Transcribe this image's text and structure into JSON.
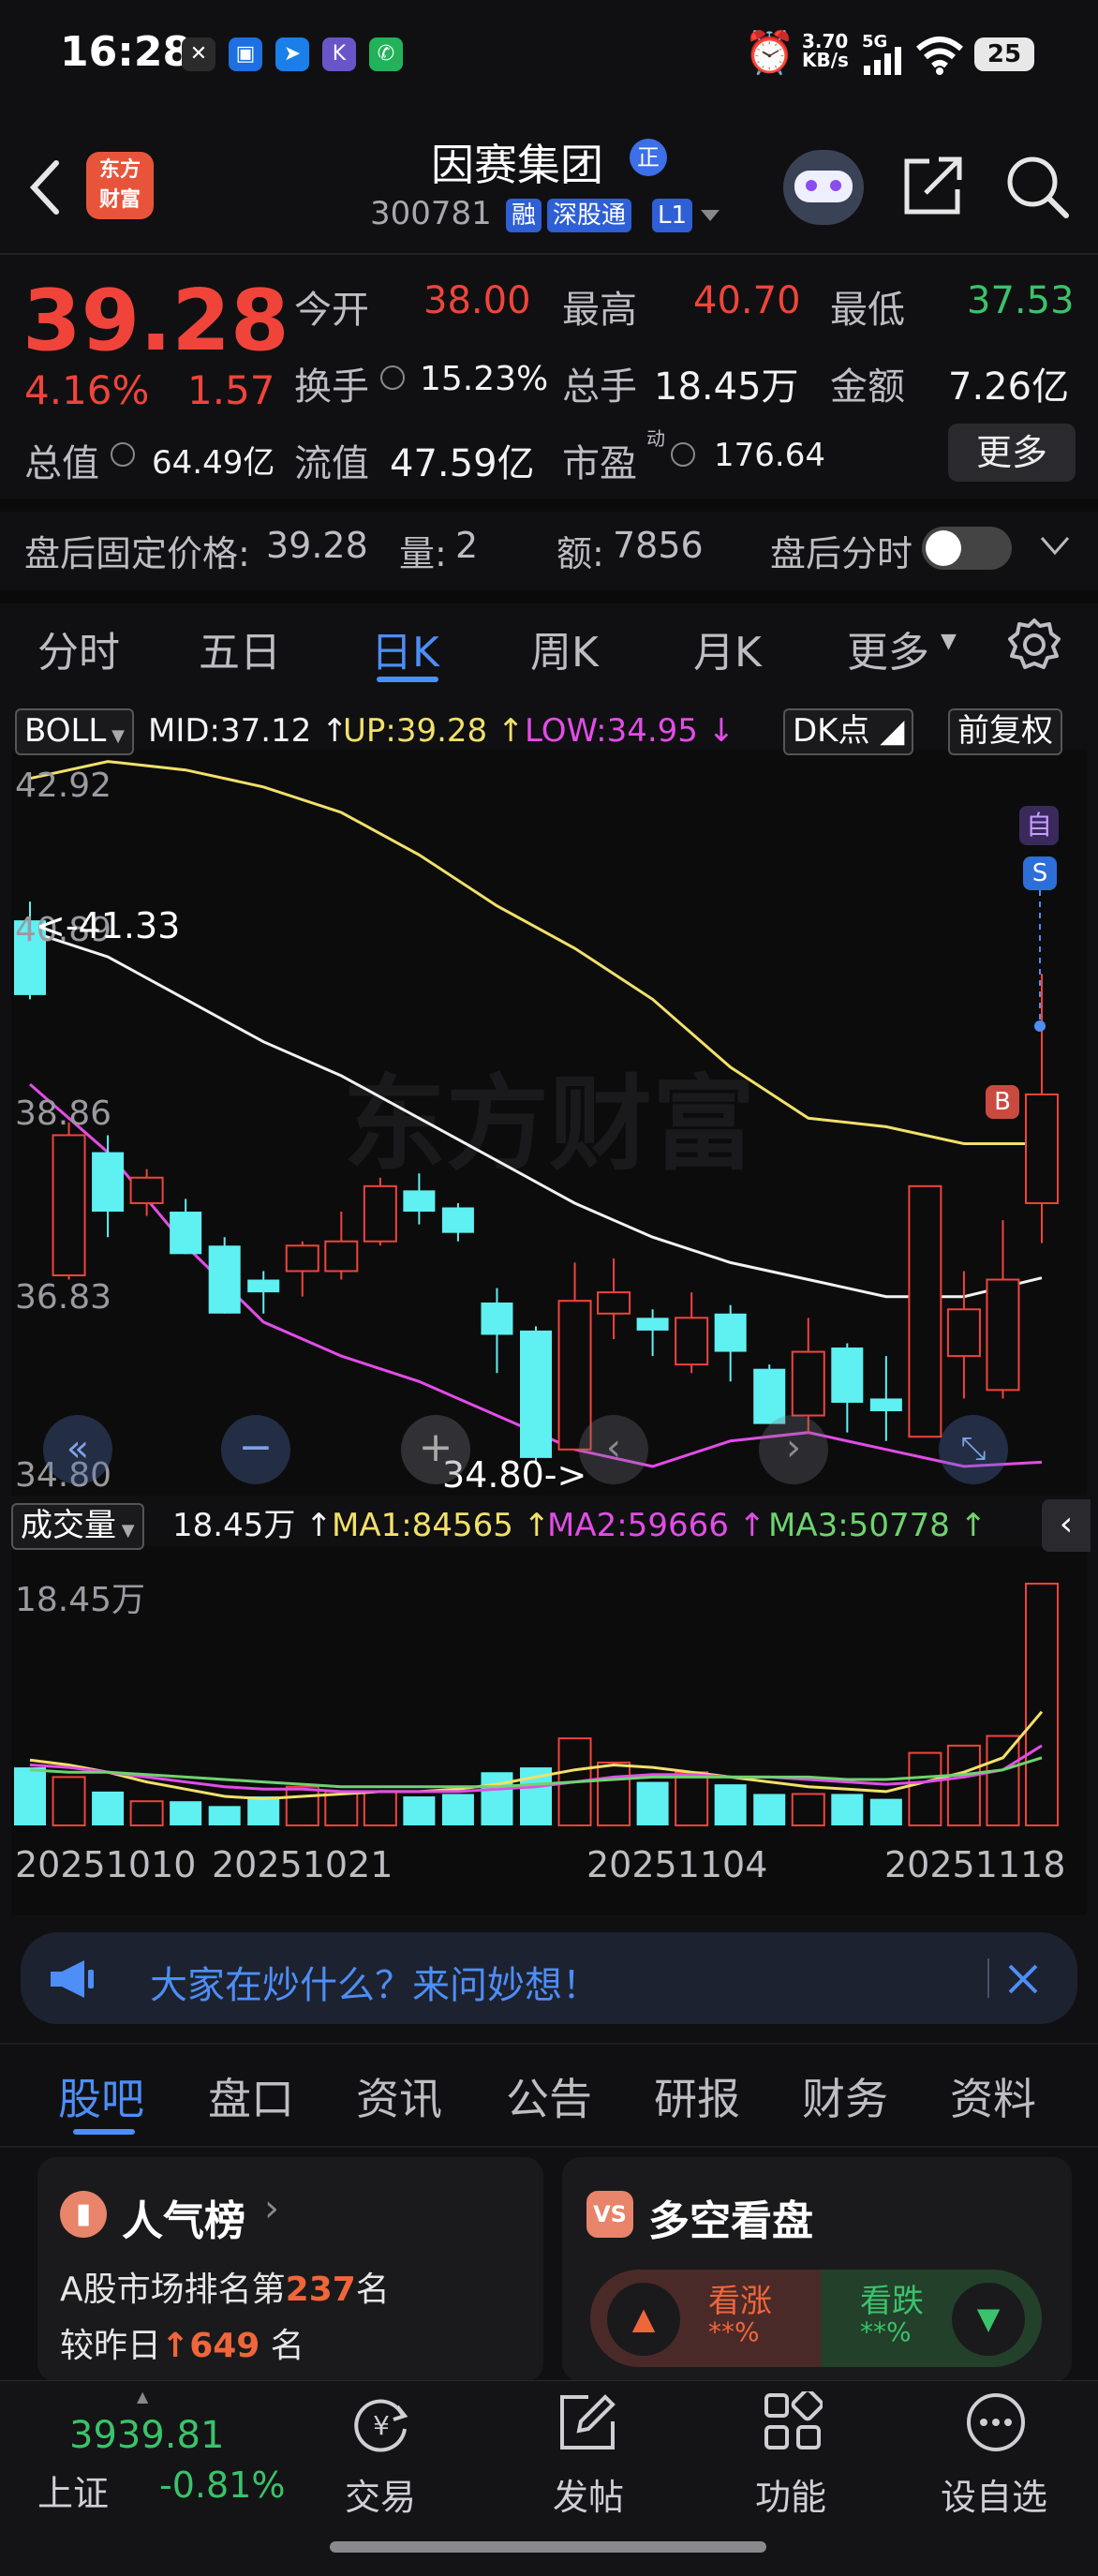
{
  "status_bar": {
    "time": "16:28",
    "net_speed_value": "3.70",
    "net_speed_unit": "KB/s",
    "signal": "5G",
    "battery": "25"
  },
  "header": {
    "stock_name": "因赛集团",
    "stock_code": "300781",
    "logo_line1": "东方",
    "logo_line2": "财富",
    "badge_rong": "融",
    "badge_sgt": "深股通",
    "badge_l1": "L1"
  },
  "quote": {
    "price": "39.28",
    "change_pct": "4.16%",
    "change_amt": "1.57",
    "open_label": "今开",
    "open": "38.00",
    "high_label": "最高",
    "high": "40.70",
    "low_label": "最低",
    "low": "37.53",
    "turnover_label": "换手",
    "turnover": "15.23%",
    "volume_label": "总手",
    "volume": "18.45万",
    "amount_label": "金额",
    "amount": "7.26亿",
    "mktcap_label": "总值",
    "mktcap": "64.49亿",
    "float_label": "流值",
    "float": "47.59亿",
    "pe_label": "市盈",
    "pe_sup": "动",
    "pe": "176.64",
    "more_label": "更多"
  },
  "after_hours": {
    "price_label": "盘后固定价格:",
    "price": "39.28",
    "qty_label": "量:",
    "qty": "2",
    "amt_label": "额:",
    "amt": "7856",
    "timeshare_label": "盘后分时"
  },
  "period_tabs": [
    "分时",
    "五日",
    "日K",
    "周K",
    "月K",
    "更多"
  ],
  "period_active": 2,
  "indicator": {
    "name": "BOLL",
    "mid": "MID:37.12",
    "up": "UP:39.28",
    "low": "LOW:34.95",
    "dk_label": "DK点",
    "adjust_label": "前复权"
  },
  "chart_axis": {
    "y_ticks": [
      "42.92",
      "40.89",
      "38.86",
      "36.83",
      "34.80"
    ],
    "max_marker": "<-41.33",
    "min_marker": "34.80->",
    "watermark": "东方财富",
    "self_select_mark": "自",
    "buy_mark": "B",
    "sell_mark": "S"
  },
  "volume_panel": {
    "name": "成交量",
    "vol": "18.45万",
    "ma1": "MA1:84565",
    "ma2": "MA2:59666",
    "ma3": "MA3:50778",
    "top_tick": "18.45万",
    "dates": [
      "20251010",
      "20251021",
      "20251104",
      "20251118"
    ]
  },
  "banner": {
    "text": "大家在炒什么？来问妙想！"
  },
  "community_tabs": [
    "股吧",
    "盘口",
    "资讯",
    "公告",
    "研报",
    "财务",
    "资料"
  ],
  "community_active": 0,
  "cards": {
    "popularity": {
      "title": "人气榜",
      "line1_prefix": "A股市场排名第",
      "rank": "237",
      "line1_suffix": "名",
      "line2_prefix": "较昨日",
      "change": "649",
      "line2_suffix": "名"
    },
    "sentiment": {
      "title": "多空看盘",
      "bull_label": "看涨",
      "bull_value": "**%",
      "bear_label": "看跌",
      "bear_value": "**%"
    }
  },
  "bottom_nav": {
    "index_value": "3939.81",
    "index_name": "上证",
    "index_change": "-0.81%",
    "items": [
      "交易",
      "发帖",
      "功能",
      "设自选"
    ]
  },
  "chart_data": {
    "type": "candlestick",
    "title": "",
    "candles": [
      {
        "o": 41.33,
        "c": 40.45,
        "h": 41.55,
        "l": 40.4
      },
      {
        "o": 37.15,
        "c": 38.8,
        "h": 38.95,
        "l": 37.1
      },
      {
        "o": 38.6,
        "c": 37.9,
        "h": 38.8,
        "l": 37.6
      },
      {
        "o": 38.0,
        "c": 38.3,
        "h": 38.4,
        "l": 37.85
      },
      {
        "o": 37.9,
        "c": 37.4,
        "h": 38.05,
        "l": 37.4
      },
      {
        "o": 37.5,
        "c": 36.7,
        "h": 37.6,
        "l": 36.7
      },
      {
        "o": 37.1,
        "c": 36.95,
        "h": 37.2,
        "l": 36.7
      },
      {
        "o": 37.2,
        "c": 37.5,
        "h": 37.55,
        "l": 36.9
      },
      {
        "o": 37.2,
        "c": 37.55,
        "h": 37.9,
        "l": 37.1
      },
      {
        "o": 37.55,
        "c": 38.2,
        "h": 38.3,
        "l": 37.5
      },
      {
        "o": 38.15,
        "c": 37.9,
        "h": 38.35,
        "l": 37.75
      },
      {
        "o": 37.95,
        "c": 37.65,
        "h": 38.0,
        "l": 37.55
      },
      {
        "o": 36.83,
        "c": 36.45,
        "h": 37.0,
        "l": 36.0
      },
      {
        "o": 36.5,
        "c": 35.0,
        "h": 36.55,
        "l": 34.95
      },
      {
        "o": 35.1,
        "c": 36.85,
        "h": 37.3,
        "l": 35.1
      },
      {
        "o": 36.7,
        "c": 36.95,
        "h": 37.35,
        "l": 36.4
      },
      {
        "o": 36.65,
        "c": 36.5,
        "h": 36.75,
        "l": 36.2
      },
      {
        "o": 36.1,
        "c": 36.65,
        "h": 36.95,
        "l": 36.0
      },
      {
        "o": 36.7,
        "c": 36.25,
        "h": 36.8,
        "l": 35.9
      },
      {
        "o": 36.05,
        "c": 35.4,
        "h": 36.1,
        "l": 35.4
      },
      {
        "o": 35.5,
        "c": 36.25,
        "h": 36.65,
        "l": 35.3
      },
      {
        "o": 36.3,
        "c": 35.65,
        "h": 36.35,
        "l": 35.3
      },
      {
        "o": 35.7,
        "c": 35.55,
        "h": 36.2,
        "l": 35.2
      },
      {
        "o": 35.25,
        "c": 38.2,
        "h": 38.2,
        "l": 35.25
      },
      {
        "o": 36.2,
        "c": 36.75,
        "h": 37.2,
        "l": 35.7
      },
      {
        "o": 35.8,
        "c": 37.1,
        "h": 37.8,
        "l": 35.7
      },
      {
        "o": 38.0,
        "c": 39.28,
        "h": 40.7,
        "l": 37.53
      }
    ],
    "boll_up": [
      43.0,
      43.2,
      43.1,
      42.9,
      42.6,
      42.1,
      41.5,
      41.0,
      40.4,
      39.6,
      39.0,
      38.9,
      38.7,
      38.7
    ],
    "boll_mid": [
      41.2,
      40.9,
      40.4,
      39.9,
      39.5,
      39.0,
      38.5,
      38.0,
      37.6,
      37.3,
      37.1,
      36.9,
      36.9,
      37.12
    ],
    "boll_low": [
      39.4,
      38.6,
      37.5,
      36.6,
      36.2,
      35.9,
      35.5,
      35.1,
      34.9,
      35.2,
      35.3,
      35.1,
      34.9,
      34.95
    ],
    "volume": [
      24,
      20,
      14,
      10,
      10,
      8,
      12,
      16,
      14,
      14,
      12,
      13,
      22,
      24,
      36,
      26,
      18,
      22,
      17,
      13,
      13,
      13,
      11,
      30,
      33,
      37,
      100
    ],
    "vol_ma1": [
      27,
      25,
      22,
      18,
      15,
      12,
      11,
      12,
      13,
      14,
      14,
      15,
      17,
      20,
      23,
      25,
      24,
      22,
      20,
      18,
      16,
      15,
      14,
      18,
      22,
      28,
      47
    ],
    "vol_ma2": [
      25,
      24,
      22,
      20,
      18,
      16,
      15,
      15,
      14,
      14,
      14,
      14,
      15,
      16,
      18,
      20,
      21,
      21,
      20,
      20,
      19,
      18,
      17,
      18,
      20,
      23,
      33
    ],
    "vol_ma3": [
      23,
      22,
      22,
      21,
      20,
      19,
      18,
      17,
      16,
      16,
      16,
      16,
      16,
      17,
      18,
      19,
      20,
      20,
      20,
      20,
      20,
      19,
      19,
      20,
      21,
      23,
      28
    ],
    "ylim": [
      34.8,
      42.92
    ],
    "vol_max": "18.45万"
  }
}
